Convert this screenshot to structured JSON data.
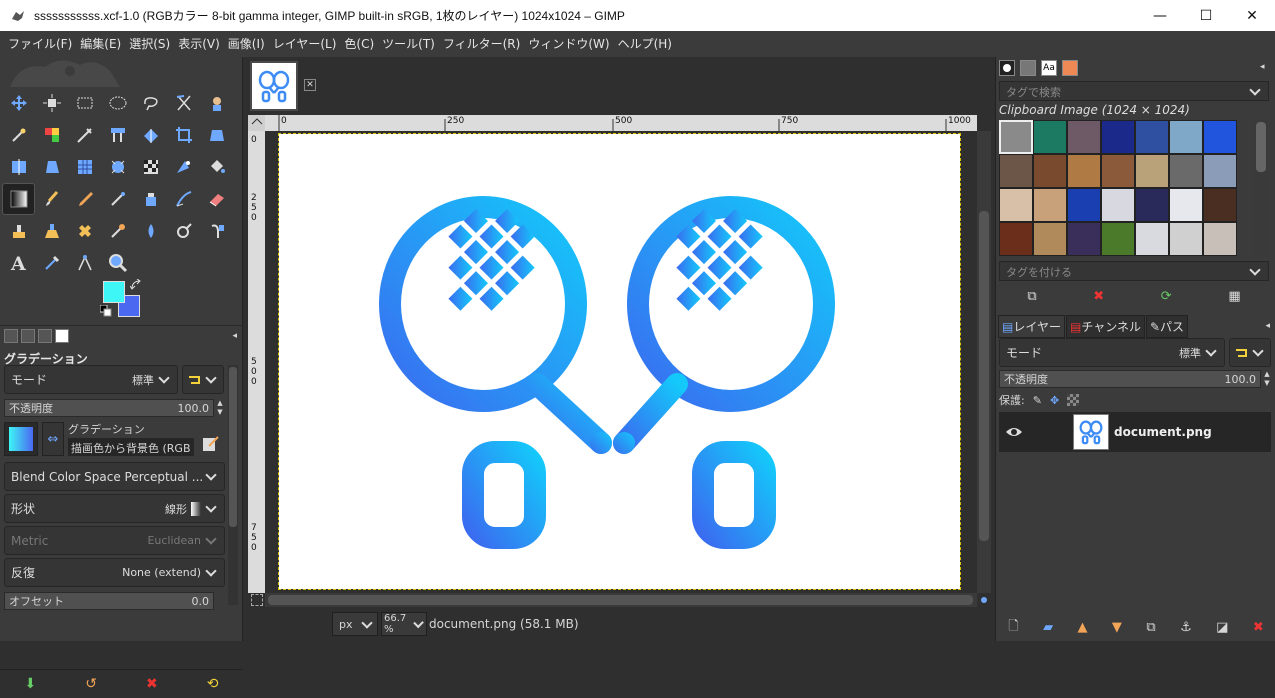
{
  "window": {
    "title": "sssssssssss.xcf-1.0 (RGBカラー 8-bit gamma integer, GIMP built-in sRGB, 1枚のレイヤー) 1024x1024 – GIMP",
    "minimize": "—",
    "maximize": "☐",
    "close": "✕"
  },
  "menu": [
    "ファイル(F)",
    "編集(E)",
    "選択(S)",
    "表示(V)",
    "画像(I)",
    "レイヤー(L)",
    "色(C)",
    "ツール(T)",
    "フィルター(R)",
    "ウィンドウ(W)",
    "ヘルプ(H)"
  ],
  "tool_options": {
    "heading": "グラデーション",
    "mode_label": "モード",
    "mode_value": "標準",
    "opacity_label": "不透明度",
    "opacity_value": "100.0",
    "gradient_label": "グラデーション",
    "gradient_value": "描画色から背景色 (RGB",
    "blend_space": "Blend Color Space Perceptual ...",
    "shape_label": "形状",
    "shape_value": "線形",
    "metric_label": "Metric",
    "metric_value": "Euclidean",
    "repeat_label": "反復",
    "repeat_value": "None (extend)",
    "offset_label": "オフセット",
    "offset_value": "0.0"
  },
  "rulers": {
    "top": [
      "0",
      "250",
      "500",
      "750",
      "1000"
    ],
    "left": [
      "0",
      "2 5 0",
      "5 0 0",
      "7 5 0"
    ]
  },
  "status": {
    "unit": "px",
    "zoom": "66.7 %",
    "file": "document.png (58.1 MB)"
  },
  "patterns": {
    "search_placeholder": "タグで検索",
    "title": "Clipboard Image (1024 × 1024)",
    "tag_placeholder": "タグを付ける",
    "swatches": [
      "#8a8a8a",
      "#1c7a63",
      "#6d5a66",
      "#1b2a8a",
      "#2f4fa0",
      "#7fa7c7",
      "#2255dd",
      "#6b5648",
      "#7a4a2e",
      "#b07a45",
      "#8a5a3a",
      "#b9a27a",
      "#6a6a6a",
      "#8b9cb8",
      "#d8c0a8",
      "#c8a07a",
      "#1a3fb0",
      "#d8d8e0",
      "#2a2a5a",
      "#e6e8ee",
      "#4a2e22",
      "#6a2e1a",
      "#b08a5a",
      "#3a2e5a",
      "#4a7a2a",
      "#d8dadf",
      "#d0d0d0",
      "#c8c0b8"
    ]
  },
  "layers": {
    "tabs": [
      "レイヤー",
      "チャンネル",
      "パス"
    ],
    "mode_label": "モード",
    "mode_value": "標準",
    "opacity_label": "不透明度",
    "opacity_value": "100.0",
    "lock_label": "保護:",
    "layer_name": "document.png"
  },
  "colors": {
    "fg": "#3ef6f6",
    "bg": "#4a68f0",
    "racket_start": "#3a6cf0",
    "racket_end": "#14c8fa"
  }
}
